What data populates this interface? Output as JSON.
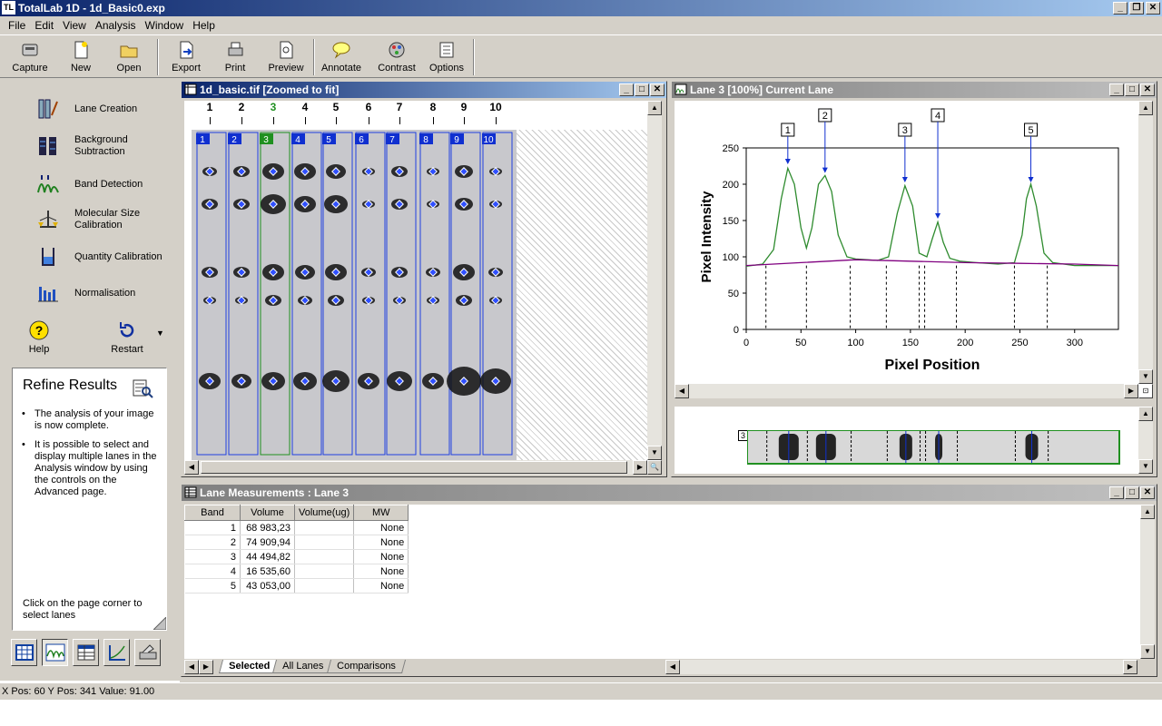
{
  "app": {
    "title": "TotalLab 1D - 1d_Basic0.exp",
    "icon": "TL"
  },
  "menu": [
    "File",
    "Edit",
    "View",
    "Analysis",
    "Window",
    "Help"
  ],
  "toolbar": [
    {
      "label": "Capture",
      "icon": "capture-icon"
    },
    {
      "label": "New",
      "icon": "new-icon"
    },
    {
      "label": "Open",
      "icon": "open-icon"
    },
    {
      "label": "Export",
      "icon": "export-icon"
    },
    {
      "label": "Print",
      "icon": "print-icon"
    },
    {
      "label": "Preview",
      "icon": "preview-icon"
    },
    {
      "label": "Annotate",
      "icon": "annotate-icon"
    },
    {
      "label": "Contrast",
      "icon": "contrast-icon"
    },
    {
      "label": "Options",
      "icon": "options-icon"
    }
  ],
  "tools": [
    {
      "label": "Lane Creation"
    },
    {
      "label": "Background Subtraction"
    },
    {
      "label": "Band Detection"
    },
    {
      "label": "Molecular Size Calibration"
    },
    {
      "label": "Quantity Calibration"
    },
    {
      "label": "Normalisation"
    }
  ],
  "help_label": "Help",
  "restart_label": "Restart",
  "refine": {
    "title": "Refine Results",
    "bullets": [
      "The analysis of your image is now complete.",
      "It is possible to select and display multiple lanes in the Analysis window by using the controls on the Advanced page."
    ],
    "footer": "Click on the page corner to select lanes"
  },
  "image_window": {
    "title": "1d_basic.tif [Zoomed to fit]",
    "lanes": [
      "1",
      "2",
      "3",
      "4",
      "5",
      "6",
      "7",
      "8",
      "9",
      "10"
    ],
    "selected_lane": "3"
  },
  "profile_window": {
    "title": "Lane 3 [100%] Current Lane",
    "strip_label": "3"
  },
  "chart_data": {
    "type": "line",
    "xlabel": "Pixel Position",
    "ylabel": "Pixel Intensity",
    "xlim": [
      0,
      340
    ],
    "ylim": [
      0,
      250
    ],
    "xticks": [
      0,
      50,
      100,
      150,
      200,
      250,
      300
    ],
    "yticks": [
      0,
      50,
      100,
      150,
      200,
      250
    ],
    "series": [
      {
        "color": "#2e8b2e",
        "x": [
          0,
          15,
          25,
          32,
          38,
          44,
          50,
          55,
          60,
          66,
          72,
          78,
          84,
          92,
          100,
          110,
          120,
          130,
          138,
          145,
          152,
          158,
          165,
          170,
          175,
          180,
          186,
          195,
          210,
          230,
          245,
          252,
          256,
          260,
          265,
          272,
          280,
          300,
          340
        ],
        "y": [
          87,
          90,
          110,
          180,
          222,
          200,
          140,
          112,
          140,
          200,
          212,
          190,
          130,
          100,
          97,
          96,
          95,
          100,
          160,
          198,
          170,
          105,
          100,
          125,
          148,
          120,
          98,
          94,
          92,
          90,
          92,
          130,
          180,
          200,
          170,
          105,
          92,
          88,
          88
        ]
      },
      {
        "color": "#800080",
        "x": [
          0,
          50,
          100,
          150,
          200,
          250,
          300,
          340
        ],
        "y": [
          88,
          92,
          96,
          94,
          92,
          91,
          90,
          88
        ]
      }
    ],
    "peaks": [
      {
        "label": "1",
        "x": 38
      },
      {
        "label": "2",
        "x": 72
      },
      {
        "label": "3",
        "x": 145
      },
      {
        "label": "4",
        "x": 175
      },
      {
        "label": "5",
        "x": 260
      }
    ],
    "boundaries": [
      18,
      55,
      95,
      128,
      158,
      163,
      192,
      245,
      275
    ]
  },
  "measurements": {
    "title": "Lane Measurements : Lane 3",
    "headers": [
      "Band",
      "Volume",
      "Volume(ug)",
      "MW"
    ],
    "rows": [
      [
        "1",
        "68 983,23",
        "",
        "None"
      ],
      [
        "2",
        "74 909,94",
        "",
        "None"
      ],
      [
        "3",
        "44 494,82",
        "",
        "None"
      ],
      [
        "4",
        "16 535,60",
        "",
        "None"
      ],
      [
        "5",
        "43 053,00",
        "",
        "None"
      ]
    ],
    "tabs": [
      "Selected",
      "All Lanes",
      "Comparisons"
    ]
  },
  "status": "X Pos: 60 Y Pos: 341 Value: 91.00"
}
